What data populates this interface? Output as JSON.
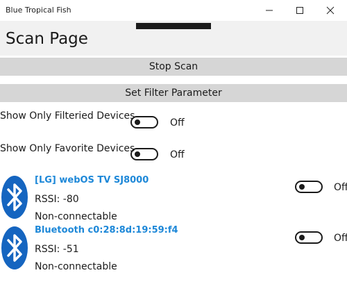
{
  "window": {
    "title": "Blue Tropical Fish",
    "controls": {
      "minimize": "minimize-icon",
      "maximize": "maximize-icon",
      "close": "close-icon"
    }
  },
  "page": {
    "title": "Scan Page"
  },
  "buttons": {
    "stop_scan": "Stop Scan",
    "set_filter": "Set Filter Parameter"
  },
  "options": [
    {
      "label": "Show Only Filteried Devices",
      "state": "Off"
    },
    {
      "label": "Show Only Favorite Devices",
      "state": "Off"
    }
  ],
  "devices": [
    {
      "name": "[LG] webOS TV SJ8000",
      "rssi": "RSSI: -80",
      "connectable": "Non-connectable",
      "state": "Off",
      "icon": "bluetooth-icon"
    },
    {
      "name": "Bluetooth c0:28:8d:19:59:f4",
      "rssi": "RSSI: -51",
      "connectable": "Non-connectable",
      "state": "Off",
      "icon": "bluetooth-icon"
    }
  ],
  "colors": {
    "accent": "#1e88d8",
    "bluetooth": "#1565c0",
    "button_bg": "#d6d6d6",
    "header_bg": "#f1f1f1"
  }
}
